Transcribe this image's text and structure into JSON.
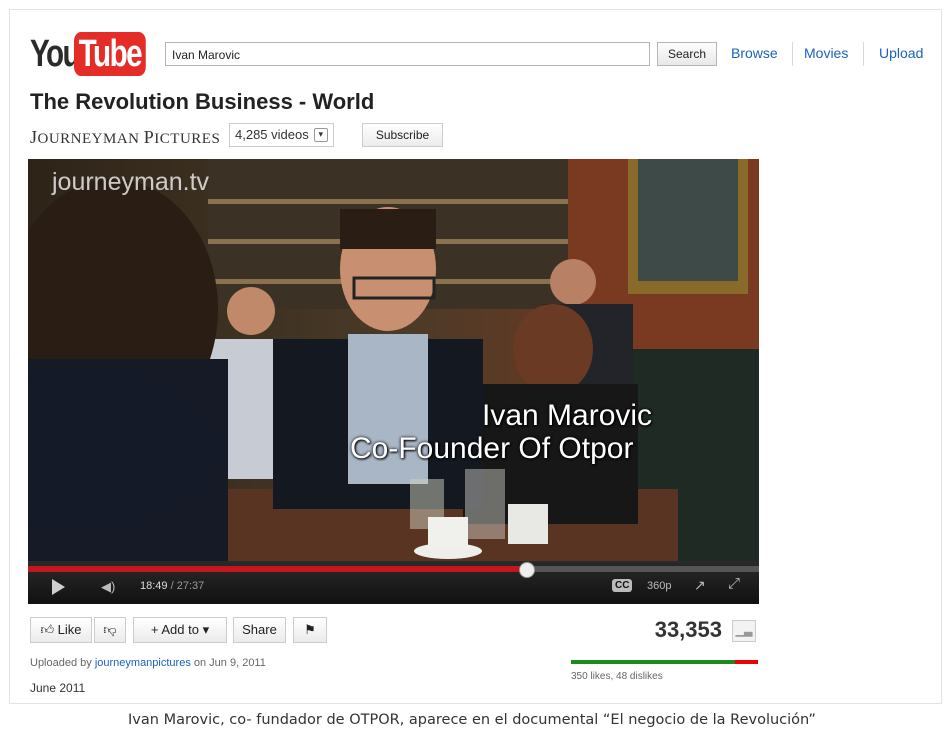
{
  "header": {
    "logo_you": "You",
    "logo_tube": "Tube",
    "search_value": "Ivan Marovic",
    "search_button": "Search",
    "links": [
      "Browse",
      "Movies",
      "Upload"
    ]
  },
  "video": {
    "title": "The Revolution Business - World",
    "channel_small_j": "J",
    "channel_rest1": "OURNEYMAN",
    "channel_small_p": "P",
    "channel_rest2": "ICTURES",
    "video_count": "4,285 videos",
    "subscribe_label": "Subscribe",
    "watermark": "journeyman.tv",
    "caption_line1": "Ivan Marovic",
    "caption_line2": "Co-Founder Of Otpor",
    "current_time": "18:49",
    "duration": "/ 27:37",
    "progress_fraction": 0.681,
    "quality": "360p",
    "cc_label": "CC"
  },
  "actions": {
    "like_label": "Like",
    "add_to_label": "Add to",
    "share_label": "Share"
  },
  "stats": {
    "views": "33,353",
    "likes_text": "350 likes, 48 dislikes",
    "like_fraction": 0.879
  },
  "upload": {
    "prefix": "Uploaded by ",
    "user": "journeymanpictures",
    "suffix": " on Jun 9, 2011",
    "date_label": "June 2011"
  },
  "caption": "Ivan Marovic, co- fundador de OTPOR, aparece en el documental “El negocio de la Revolución”",
  "colors": {
    "brand_red": "#e52d27",
    "link_blue": "#1c62b9",
    "progress_red": "#c4161c",
    "like_green": "#1d8a1d"
  }
}
